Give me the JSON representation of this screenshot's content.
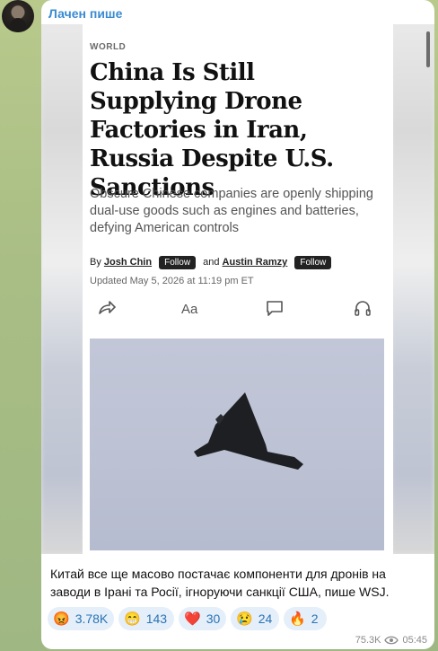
{
  "channel": {
    "author": "Лачен пише"
  },
  "article": {
    "section": "WORLD",
    "headline": "China Is Still Supplying Drone Factories in Iran, Russia Despite U.S. Sanctions",
    "dek": "Obscure Chinese companies are openly shipping dual-use goods such as engines and batteries, defying American controls",
    "byline": {
      "by": "By",
      "author1": "Josh Chin",
      "and": "and",
      "author2": "Austin Ramzy",
      "follow": "Follow"
    },
    "updated": "Updated May 5, 2026 at 11:19 pm ET",
    "tools": [
      "share-icon",
      "text-size-icon",
      "comment-icon",
      "headphones-icon"
    ]
  },
  "message": {
    "caption": "Китай все ще масово постачає компоненти для дронів на заводи в Ірані та Росії, ігноруючи санкції США, пише WSJ.",
    "reactions": [
      {
        "emoji": "😡",
        "count": "3.78K"
      },
      {
        "emoji": "😁",
        "count": "143"
      },
      {
        "emoji": "❤️",
        "count": "30"
      },
      {
        "emoji": "😢",
        "count": "24"
      },
      {
        "emoji": "🔥",
        "count": "2"
      }
    ],
    "views": "75.3K",
    "time": "05:45"
  }
}
